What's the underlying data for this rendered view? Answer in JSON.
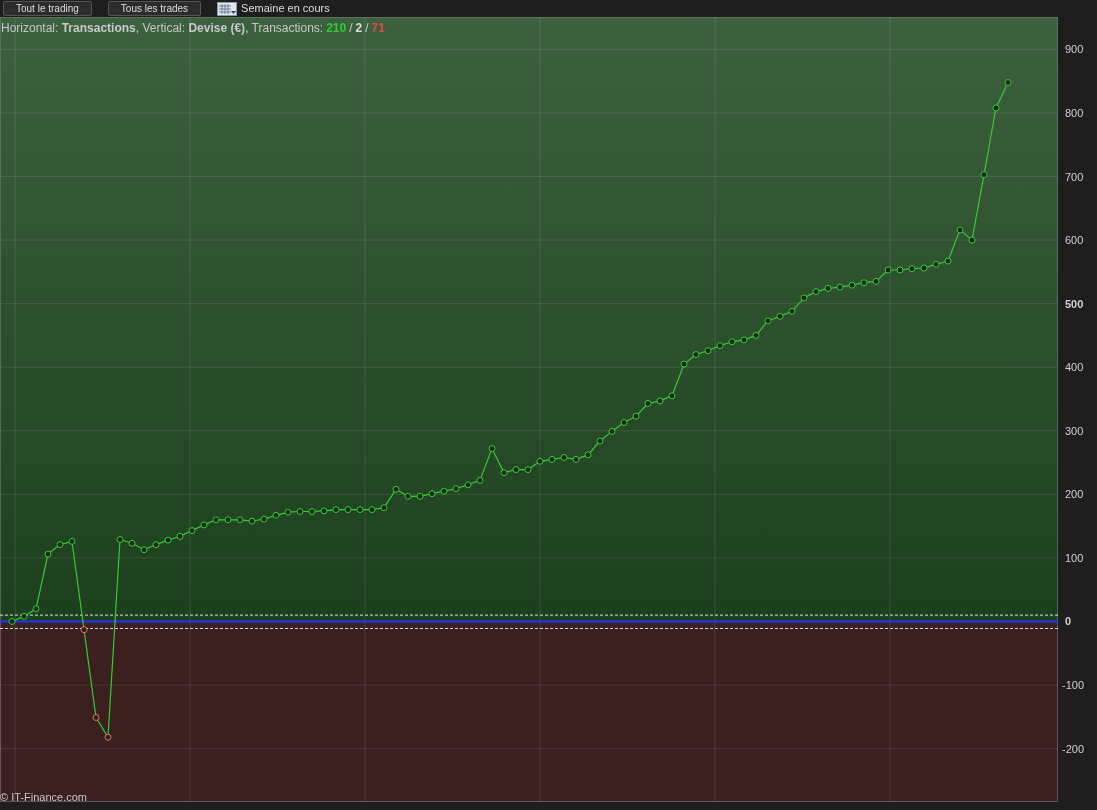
{
  "toolbar": {
    "buttons": [
      "Tout le trading",
      "Tous les trades"
    ],
    "period": "Semaine en cours"
  },
  "chart": {
    "header": {
      "text": "Horizontal: **Transactions**, Vertical: **Devise (€)**, Transactions:",
      "separator": "/",
      "counts": [
        {
          "value": "210",
          "color": "#33cc33"
        },
        {
          "value": "2",
          "color": "#dddddd"
        },
        {
          "value": "71",
          "color": "#e04848"
        }
      ]
    },
    "chart_data": {
      "type": "line",
      "ylim": [
        -284,
        951
      ],
      "grid": true,
      "marker": "o",
      "bands": [
        {
          "axis": "y",
          "from": -284,
          "to": 0,
          "color": "#3c1f1f"
        }
      ],
      "ref_lines": [
        {
          "axis": "y",
          "value": 10,
          "color": "#e0e0e0"
        },
        {
          "axis": "y",
          "value": 0,
          "color": "#2233ff"
        },
        {
          "axis": "y",
          "value": -11,
          "color": "#e0e0e0"
        }
      ],
      "yticks": [
        {
          "value": 900,
          "label": "900"
        },
        {
          "value": 800,
          "label": "800"
        },
        {
          "value": 700,
          "label": "700"
        },
        {
          "value": 600,
          "label": "600"
        },
        {
          "value": 500,
          "label": "500"
        },
        {
          "value": 400,
          "label": "400"
        },
        {
          "value": 300,
          "label": "300"
        },
        {
          "value": 200,
          "label": "200"
        },
        {
          "value": 100,
          "label": "100"
        },
        {
          "value": 0,
          "label": "0"
        },
        {
          "value": -100,
          "label": "-100"
        },
        {
          "value": -200,
          "label": "-200"
        }
      ],
      "categories": [
        null,
        null,
        null,
        null,
        null,
        null,
        null,
        null,
        null,
        null,
        null,
        null,
        null,
        null,
        null,
        null,
        null,
        null,
        null,
        null,
        null,
        null,
        null,
        null,
        null,
        null,
        null,
        null,
        null,
        null,
        null,
        null,
        null,
        null,
        null,
        null,
        null,
        null,
        null,
        null,
        null,
        null,
        null,
        null,
        null,
        null,
        null,
        null,
        null,
        null,
        null,
        null,
        null,
        null,
        null,
        null,
        null,
        null,
        null,
        null,
        null,
        null,
        null,
        null,
        null,
        null,
        null,
        null,
        null,
        null,
        null,
        null,
        null,
        null,
        null,
        null,
        null,
        null,
        null,
        null,
        null,
        null,
        null,
        null
      ],
      "values": [
        0,
        8,
        20,
        106,
        121,
        126,
        -13,
        -151,
        -182,
        129,
        123,
        113,
        121,
        128,
        134,
        143,
        152,
        160,
        160,
        160,
        158,
        161,
        167,
        172,
        173,
        173,
        174,
        176,
        176,
        176,
        176,
        179,
        208,
        197,
        197,
        201,
        205,
        209,
        215,
        222,
        272,
        234,
        239,
        239,
        252,
        255,
        258,
        255,
        262,
        284,
        299,
        313,
        323,
        343,
        347,
        355,
        405,
        420,
        426,
        434,
        440,
        443,
        450,
        473,
        480,
        488,
        509,
        519,
        524,
        526,
        529,
        533,
        535,
        553,
        553,
        555,
        556,
        562,
        567,
        616,
        600,
        703,
        808,
        848
      ]
    }
  },
  "footer": "© IT-Finance.com"
}
